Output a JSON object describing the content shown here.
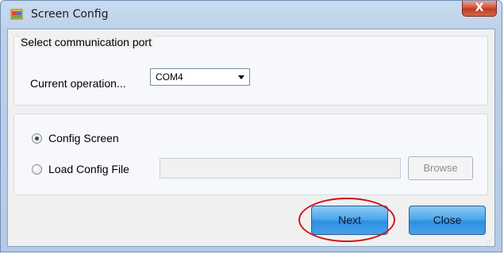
{
  "window": {
    "title": "Screen Config",
    "close_glyph": "X"
  },
  "port_group": {
    "title": "Select communication port",
    "operation_label": "Current operation...",
    "selected_port": "COM4"
  },
  "config_group": {
    "options": [
      {
        "label": "Config Screen",
        "checked": true
      },
      {
        "label": "Load Config File",
        "checked": false
      }
    ],
    "file_path_value": "",
    "browse_label": "Browse"
  },
  "footer": {
    "next_label": "Next",
    "close_label": "Close"
  },
  "icons": {
    "app": "app-window-icon",
    "dropdown": "chevron-down-icon"
  },
  "colors": {
    "button_blue": "#4ea8ec",
    "highlight_red": "#d0131a",
    "close_red": "#c23a22"
  }
}
